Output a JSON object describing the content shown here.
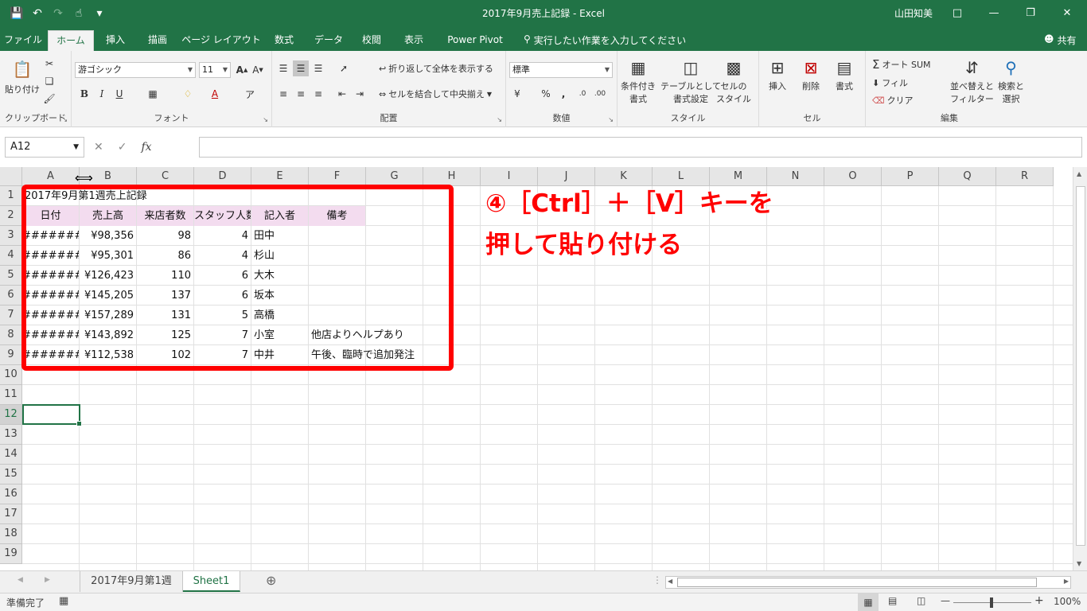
{
  "window": {
    "title": "2017年9月売上記録  -  Excel",
    "user": "山田知美"
  },
  "tabs": [
    "ファイル",
    "ホーム",
    "挿入",
    "描画",
    "ページ レイアウト",
    "数式",
    "データ",
    "校閲",
    "表示",
    "Power Pivot"
  ],
  "tellme": "実行したい作業を入力してください",
  "share": "共有",
  "ribbon": {
    "clipboard": {
      "label": "クリップボード",
      "paste": "貼り付け"
    },
    "font": {
      "label": "フォント",
      "name": "游ゴシック",
      "size": "11"
    },
    "alignment": {
      "label": "配置",
      "wrap": "折り返して全体を表示する",
      "merge": "セルを結合して中央揃え"
    },
    "number": {
      "label": "数値",
      "format": "標準"
    },
    "styles": {
      "label": "スタイル",
      "cond1": "条件付き",
      "cond2": "書式",
      "table1": "テーブルとして",
      "table2": "書式設定",
      "cell1": "セルの",
      "cell2": "スタイル"
    },
    "cells": {
      "label": "セル",
      "insert": "挿入",
      "delete": "削除",
      "format": "書式"
    },
    "editing": {
      "label": "編集",
      "autosum": "オート SUM",
      "fill": "フィル",
      "clear": "クリア",
      "sort1": "並べ替えと",
      "sort2": "フィルター",
      "find1": "検索と",
      "find2": "選択"
    }
  },
  "formula_bar": {
    "name_box": "A12",
    "fx": "fx"
  },
  "columns": [
    "A",
    "B",
    "C",
    "D",
    "E",
    "F",
    "G",
    "H",
    "I",
    "J",
    "K",
    "L",
    "M",
    "N",
    "O",
    "P",
    "Q",
    "R"
  ],
  "rows": [
    "1",
    "2",
    "3",
    "4",
    "5",
    "6",
    "7",
    "8",
    "9",
    "10",
    "11",
    "12",
    "13",
    "14",
    "15",
    "16",
    "17",
    "18",
    "19"
  ],
  "sheet": {
    "title": "2017年9月第1週売上記録",
    "headers": [
      "日付",
      "売上高",
      "来店者数",
      "スタッフ人数",
      "記入者",
      "備考"
    ],
    "data": [
      [
        "#######",
        "¥98,356",
        "98",
        "4",
        "田中",
        ""
      ],
      [
        "#######",
        "¥95,301",
        "86",
        "4",
        "杉山",
        ""
      ],
      [
        "#######",
        "¥126,423",
        "110",
        "6",
        "大木",
        ""
      ],
      [
        "#######",
        "¥145,205",
        "137",
        "6",
        "坂本",
        ""
      ],
      [
        "#######",
        "¥157,289",
        "131",
        "5",
        "高橋",
        ""
      ],
      [
        "#######",
        "¥143,892",
        "125",
        "7",
        "小室",
        "他店よりヘルプあり"
      ],
      [
        "#######",
        "¥112,538",
        "102",
        "7",
        "中井",
        "午後、臨時で追加発注"
      ]
    ]
  },
  "annotation": {
    "line1": "④［Ctrl］＋［V］キーを",
    "line2": "押して貼り付ける",
    "color": "#ff0000"
  },
  "sheet_tabs": [
    "2017年9月第1週",
    "Sheet1"
  ],
  "status": {
    "ready": "準備完了",
    "zoom": "100%"
  },
  "colors": {
    "accent": "#217346",
    "header_fill": "#f3dcef"
  }
}
